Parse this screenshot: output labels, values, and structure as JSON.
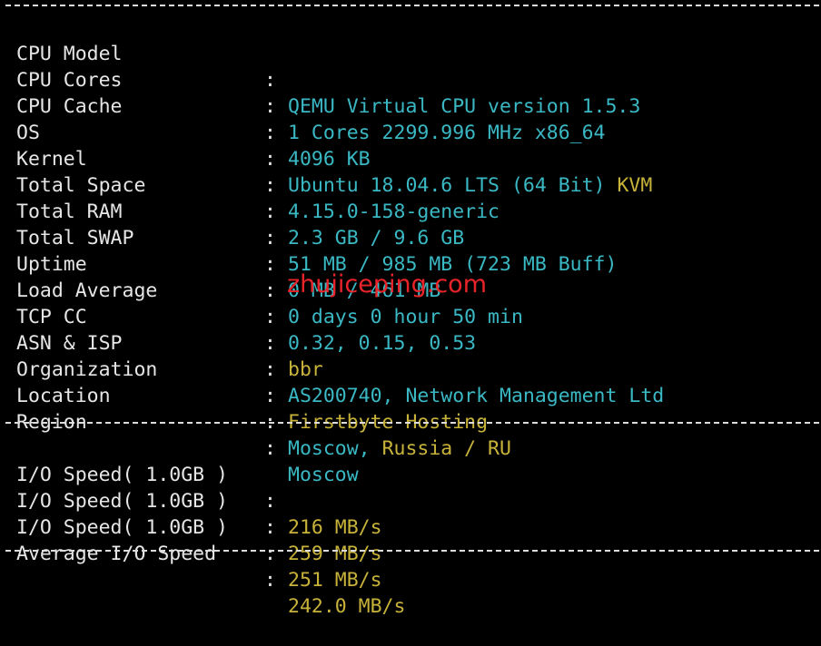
{
  "colors": {
    "background": "#000000",
    "label": "#e6e6e6",
    "cyan": "#3ab8c4",
    "yellow": "#c8b33a",
    "watermark": "#e8242a"
  },
  "separator_char": ":",
  "system_info": [
    {
      "label": "CPU Model",
      "value": "QEMU Virtual CPU version 1.5.3",
      "extra": ""
    },
    {
      "label": "CPU Cores",
      "value": "1 Cores 2299.996 MHz x86_64",
      "extra": ""
    },
    {
      "label": "CPU Cache",
      "value": "4096 KB",
      "extra": ""
    },
    {
      "label": "OS",
      "value": "Ubuntu 18.04.6 LTS (64 Bit)",
      "extra": "KVM"
    },
    {
      "label": "Kernel",
      "value": "4.15.0-158-generic",
      "extra": ""
    },
    {
      "label": "Total Space",
      "value": "2.3 GB / 9.6 GB",
      "extra": ""
    },
    {
      "label": "Total RAM",
      "value": "51 MB / 985 MB (723 MB Buff)",
      "extra": ""
    },
    {
      "label": "Total SWAP",
      "value": "0 MB / 461 MB",
      "extra": ""
    },
    {
      "label": "Uptime",
      "value": "0 days 0 hour 50 min",
      "extra": ""
    },
    {
      "label": "Load Average",
      "value": "0.32, 0.15, 0.53",
      "extra": ""
    },
    {
      "label": "TCP CC",
      "value": "bbr",
      "extra": ""
    },
    {
      "label": "ASN & ISP",
      "value": "AS200740, Network Management Ltd",
      "extra": ""
    },
    {
      "label": "Organization",
      "value": "Firstbyte Hosting",
      "extra": ""
    },
    {
      "label": "Location",
      "value": "Moscow,",
      "extra": "Russia / RU"
    },
    {
      "label": "Region",
      "value": "Moscow",
      "extra": ""
    }
  ],
  "io_info": [
    {
      "label": "I/O Speed( 1.0GB )",
      "value": "216 MB/s"
    },
    {
      "label": "I/O Speed( 1.0GB )",
      "value": "259 MB/s"
    },
    {
      "label": "I/O Speed( 1.0GB )",
      "value": "251 MB/s"
    },
    {
      "label": "Average I/O Speed",
      "value": "242.0 MB/s"
    }
  ],
  "watermark": "zhujiceping.com"
}
